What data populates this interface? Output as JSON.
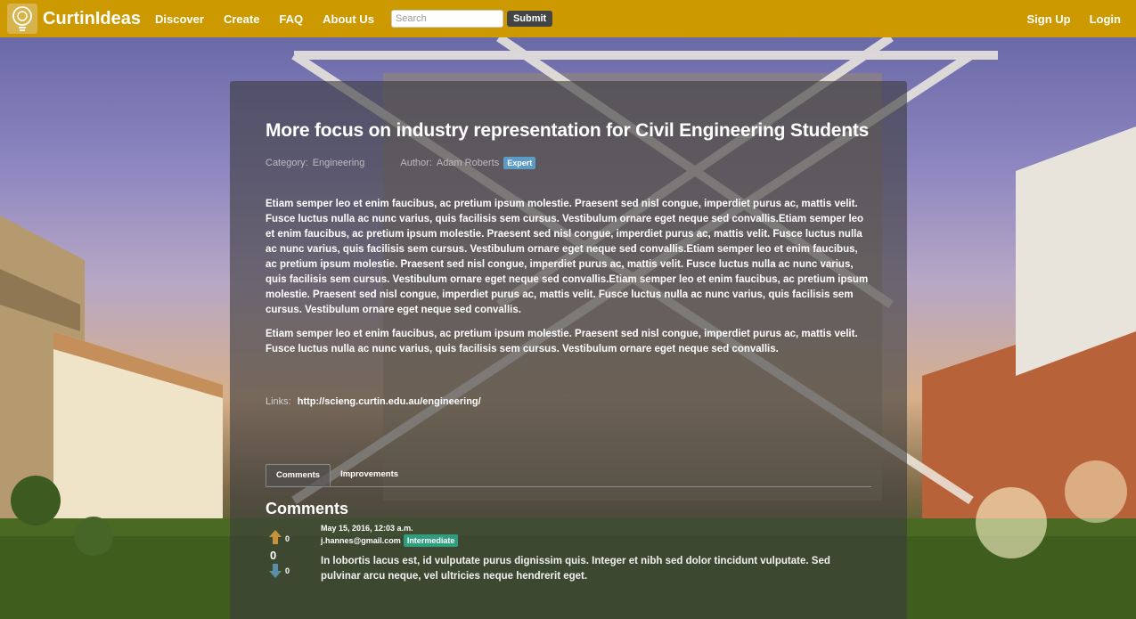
{
  "nav": {
    "brand": "CurtinIdeas",
    "links": [
      "Discover",
      "Create",
      "FAQ",
      "About Us"
    ],
    "search_placeholder": "Search",
    "submit_label": "Submit",
    "signup": "Sign Up",
    "login": "Login"
  },
  "idea": {
    "title": "More focus on industry representation for Civil Engineering Students",
    "category_label": "Category:",
    "category": "Engineering",
    "author_label": "Author:",
    "author": "Adam Roberts",
    "author_badge": "Expert",
    "paragraphs": [
      "Etiam semper leo et enim faucibus, ac pretium ipsum molestie. Praesent sed nisl congue, imperdiet purus ac, mattis velit. Fusce luctus nulla ac nunc varius, quis facilisis sem cursus. Vestibulum ornare eget neque sed convallis.Etiam semper leo et enim faucibus, ac pretium ipsum molestie. Praesent sed nisl congue, imperdiet purus ac, mattis velit. Fusce luctus nulla ac nunc varius, quis facilisis sem cursus. Vestibulum ornare eget neque sed convallis.Etiam semper leo et enim faucibus, ac pretium ipsum molestie. Praesent sed nisl congue, imperdiet purus ac, mattis velit. Fusce luctus nulla ac nunc varius, quis facilisis sem cursus. Vestibulum ornare eget neque sed convallis.Etiam semper leo et enim faucibus, ac pretium ipsum molestie. Praesent sed nisl congue, imperdiet purus ac, mattis velit. Fusce luctus nulla ac nunc varius, quis facilisis sem cursus. Vestibulum ornare eget neque sed convallis.",
      "Etiam semper leo et enim faucibus, ac pretium ipsum molestie. Praesent sed nisl congue, imperdiet purus ac, mattis velit. Fusce luctus nulla ac nunc varius, quis facilisis sem cursus. Vestibulum ornare eget neque sed convallis."
    ],
    "links_label": "Links:",
    "link_url": "http://scieng.curtin.edu.au/engineering/"
  },
  "tabs": [
    "Comments",
    "Improvements"
  ],
  "comments": {
    "heading": "Comments",
    "items": [
      {
        "date": "May 15, 2016, 12:03 a.m.",
        "user": "j.hannes@gmail.com",
        "badge": "Intermediate",
        "upvotes": "0",
        "score": "0",
        "downvotes": "0",
        "text": "In lobortis lacus est, id vulputate purus dignissim quis. Integer et nibh sed dolor tincidunt vulputate. Sed pulvinar arcu neque, vel ultricies neque hendrerit eget."
      }
    ]
  },
  "colors": {
    "navbar": "#cc9a00",
    "expert_badge": "#5b9bc6",
    "intermediate_badge": "#2e9e7c",
    "upvote_arrow": "#c8923a",
    "downvote_arrow": "#5b8fa8"
  }
}
